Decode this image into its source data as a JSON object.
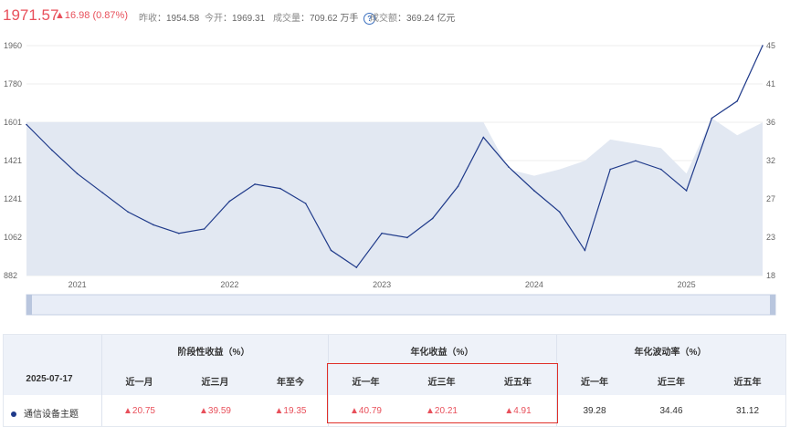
{
  "quote": {
    "price": "1971.57",
    "change": "▲16.98 (0.87%)",
    "prev_close_label": "昨收",
    "prev_close": "1954.58",
    "open_label": "今开",
    "open": "1969.31",
    "volume_label": "成交量",
    "volume": "709.62 万手",
    "turnover_label": "成交额",
    "turnover": "369.24 亿元",
    "info_icon": "info-icon"
  },
  "chart_data": {
    "type": "line",
    "x_ticks": [
      "2021",
      "2022",
      "2023",
      "2024",
      "2025"
    ],
    "y_left_ticks": [
      "1960",
      "1780",
      "1601",
      "1421",
      "1241",
      "1062",
      "882"
    ],
    "y_right_ticks": [
      "45",
      "41",
      "36",
      "32",
      "27",
      "23",
      "18"
    ],
    "ylim_left": [
      882,
      1960
    ],
    "ylim_right": [
      18,
      45
    ],
    "series": [
      {
        "color": "#1f3a8a",
        "x": [
          "2020-09",
          "2020-11",
          "2021-01",
          "2021-03",
          "2021-05",
          "2021-07",
          "2021-09",
          "2021-11",
          "2022-01",
          "2022-03",
          "2022-05",
          "2022-07",
          "2022-09",
          "2022-11",
          "2023-01",
          "2023-03",
          "2023-05",
          "2023-07",
          "2023-09",
          "2023-11",
          "2024-01",
          "2024-03",
          "2024-05",
          "2024-07",
          "2024-09",
          "2024-11",
          "2025-01",
          "2025-03",
          "2025-05",
          "2025-07"
        ],
        "values": [
          1590,
          1470,
          1360,
          1270,
          1180,
          1120,
          1080,
          1100,
          1230,
          1310,
          1290,
          1220,
          1000,
          920,
          1080,
          1060,
          1150,
          1300,
          1530,
          1390,
          1280,
          1180,
          1000,
          1380,
          1420,
          1380,
          1280,
          1620,
          1700,
          1960
        ]
      },
      {
        "color": "#c9d3e8",
        "x": [
          "2020-09",
          "2020-11",
          "2021-01",
          "2021-03",
          "2021-05",
          "2021-07",
          "2021-09",
          "2021-11",
          "2022-01",
          "2022-03",
          "2022-05",
          "2022-07",
          "2022-09",
          "2022-11",
          "2023-01",
          "2023-03",
          "2023-05",
          "2023-07",
          "2023-09",
          "2023-11",
          "2024-01",
          "2024-03",
          "2024-05",
          "2024-07",
          "2024-09",
          "2024-11",
          "2025-01",
          "2025-03",
          "2025-05",
          "2025-07"
        ],
        "values": [
          1601,
          1601,
          1601,
          1601,
          1601,
          1601,
          1601,
          1601,
          1601,
          1601,
          1601,
          1601,
          1601,
          1601,
          1601,
          1601,
          1601,
          1601,
          1601,
          1380,
          1350,
          1380,
          1420,
          1520,
          1500,
          1480,
          1360,
          1620,
          1540,
          1600
        ]
      }
    ],
    "grid": true
  },
  "table": {
    "date": "2025-07-17",
    "groups": [
      "阶段性收益（%）",
      "年化收益（%）",
      "年化波动率（%）"
    ],
    "sub_headers": [
      "近一月",
      "近三月",
      "年至今",
      "近一年",
      "近三年",
      "近五年",
      "近一年",
      "近三年",
      "近五年"
    ],
    "row": {
      "name": "通信设备主题",
      "values": [
        "▲20.75",
        "▲39.59",
        "▲19.35",
        "▲40.79",
        "▲20.21",
        "▲4.91",
        "39.28",
        "34.46",
        "31.12"
      ]
    },
    "colors": {
      "up": "#e8505b",
      "accent": "#1f3a8a",
      "highlight": "#e0302a"
    }
  }
}
